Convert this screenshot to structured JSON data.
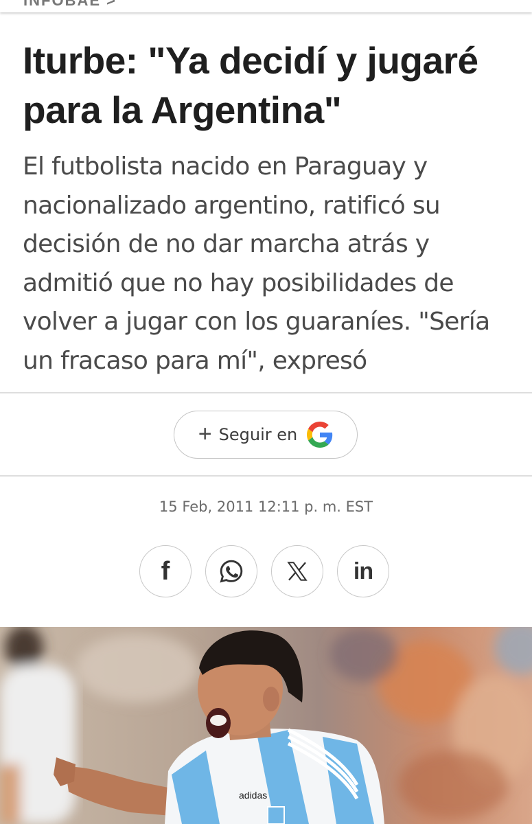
{
  "header": {
    "section_label": "INFOBAE >"
  },
  "article": {
    "title": "Iturbe: \"Ya decidí y jugaré para la Argentina\"",
    "subtitle": "El futbolista nacido en Paraguay y nacionalizado argentino, ratificó su decisión de no dar marcha atrás y admitió que no hay posibilidades de volver a jugar con los guaraníes. \"Sería un fracaso para mí\", expresó",
    "date": "15 Feb, 2011 12:11 p. m. EST"
  },
  "follow": {
    "label": "Seguir en",
    "icon": "plus-icon",
    "brand_icon": "google-g-icon"
  },
  "share": {
    "buttons": [
      {
        "icon": "facebook-icon",
        "glyph": "f"
      },
      {
        "icon": "whatsapp-icon",
        "glyph": ""
      },
      {
        "icon": "x-icon",
        "glyph": "𝕏"
      },
      {
        "icon": "linkedin-icon",
        "glyph": "in"
      }
    ]
  },
  "colors": {
    "text_primary": "#1f1f1f",
    "text_secondary": "#4a4a4a",
    "divider": "#dedede",
    "google_blue": "#4285F4",
    "google_red": "#EA4335",
    "google_yellow": "#FBBC05",
    "google_green": "#34A853",
    "argentina_sky": "#6fb6e6"
  },
  "hero_image": {
    "description_visible": false,
    "jersey_brand_text": "adidas"
  }
}
